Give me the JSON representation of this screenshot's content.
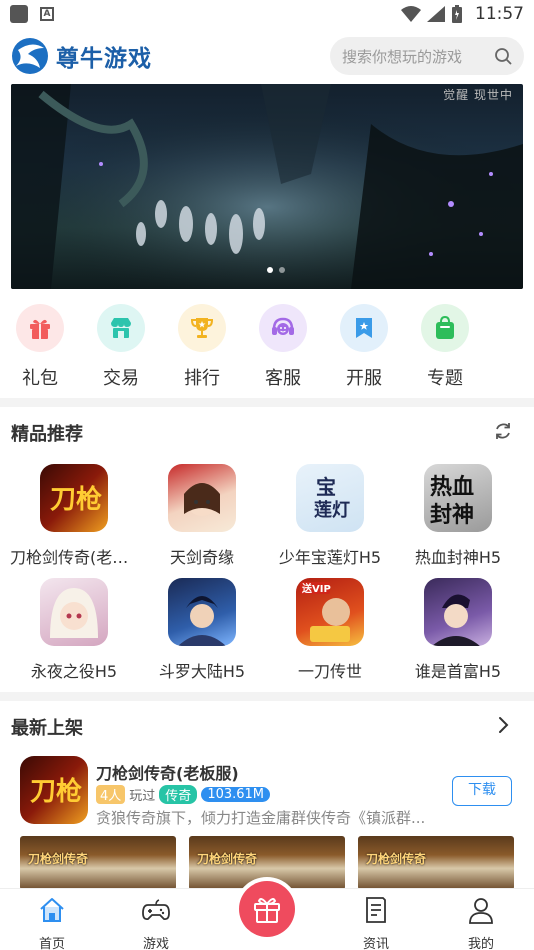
{
  "status_bar": {
    "time": "11:57"
  },
  "header": {
    "logo_text": "尊牛游戏",
    "search_placeholder": "搜索你想玩的游戏"
  },
  "banner": {
    "watermark": "觉醒 现世中"
  },
  "quick_nav": [
    {
      "label": "礼包",
      "icon": "gift-icon",
      "bg": "#fde7e7",
      "color": "#f25c5c"
    },
    {
      "label": "交易",
      "icon": "shop-icon",
      "bg": "#def6f3",
      "color": "#2cc4ad"
    },
    {
      "label": "排行",
      "icon": "trophy-icon",
      "bg": "#fdf3dc",
      "color": "#f2b321"
    },
    {
      "label": "客服",
      "icon": "headset-icon",
      "bg": "#efe6fb",
      "color": "#a36ae6"
    },
    {
      "label": "开服",
      "icon": "bookmark-icon",
      "bg": "#e2f0fb",
      "color": "#3a9be8"
    },
    {
      "label": "专题",
      "icon": "bag-icon",
      "bg": "#e2f6e6",
      "color": "#2dbd5a"
    }
  ],
  "recommended": {
    "title": "精品推荐",
    "games": [
      {
        "name": "刀枪剑传奇(老板服)"
      },
      {
        "name": "天剑奇缘"
      },
      {
        "name": "少年宝莲灯H5"
      },
      {
        "name": "热血封神H5"
      },
      {
        "name": "永夜之役H5"
      },
      {
        "name": "斗罗大陆H5"
      },
      {
        "name": "一刀传世"
      },
      {
        "name": "谁是首富H5"
      }
    ]
  },
  "newest": {
    "title": "最新上架",
    "game": {
      "title": "刀枪剑传奇(老板服)",
      "players": "4人",
      "played": "玩过",
      "genre": "传奇",
      "size": "103.61M",
      "desc": "贪狼传奇旗下，倾力打造金庸群侠传奇《镇派群...",
      "download": "下载"
    },
    "screenshot_label": "刀枪剑传奇"
  },
  "bottom_nav": [
    {
      "label": "首页",
      "icon": "home-icon"
    },
    {
      "label": "游戏",
      "icon": "gamepad-icon"
    },
    {
      "label": "资讯",
      "icon": "news-icon"
    },
    {
      "label": "我的",
      "icon": "user-icon"
    }
  ],
  "colors": {
    "accent": "#2e8ff0",
    "brand": "#1c5fa8",
    "center_button": "#ef4b5e"
  }
}
